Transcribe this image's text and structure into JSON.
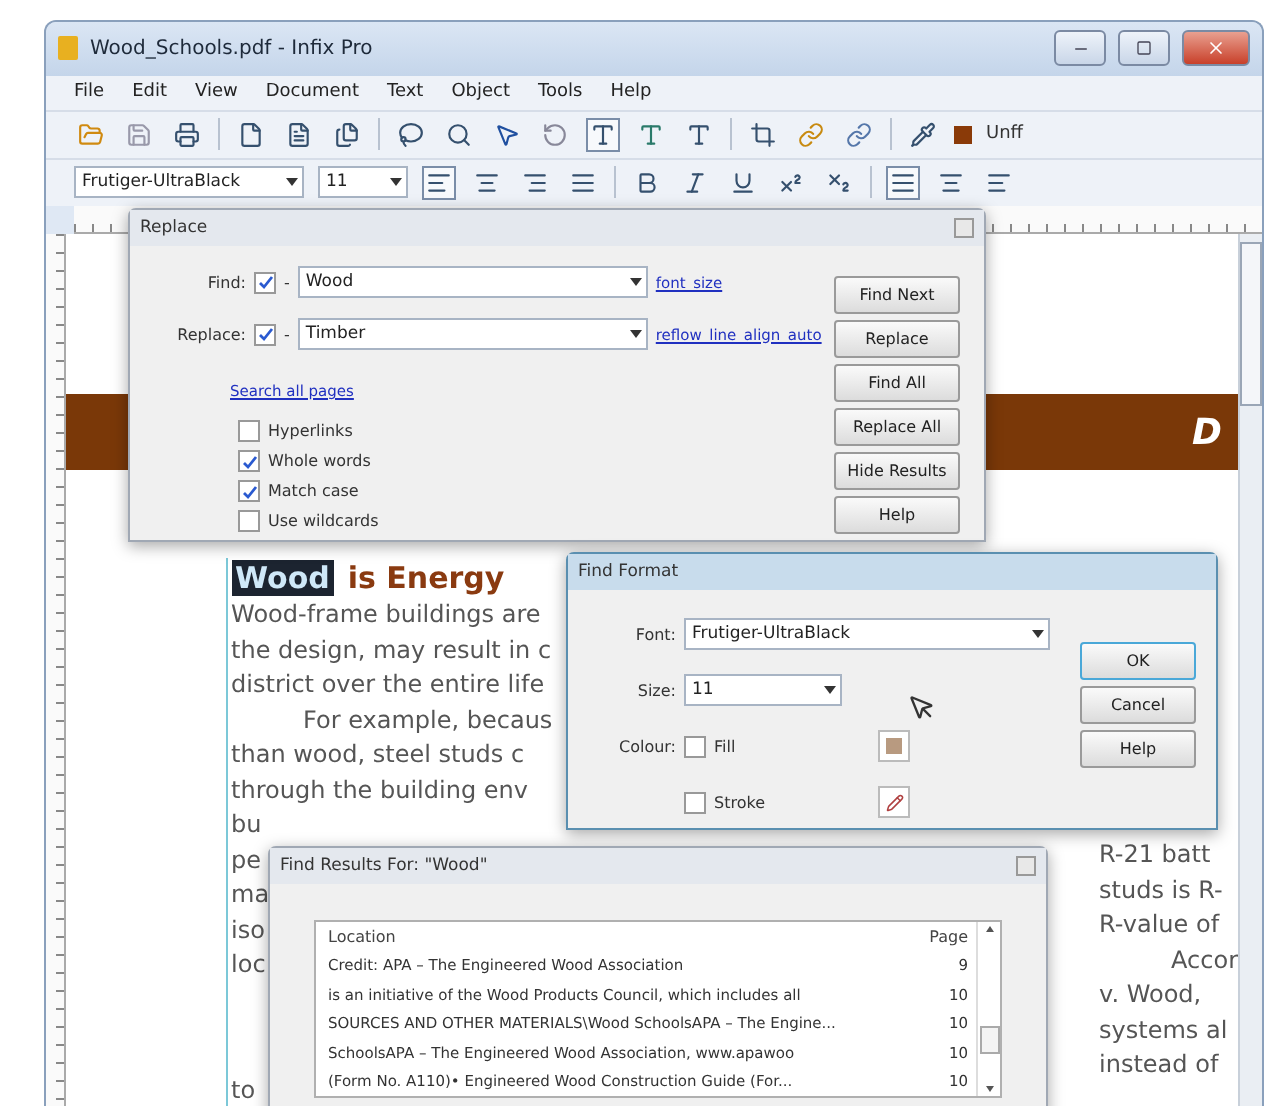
{
  "window": {
    "title": "Wood_Schools.pdf - Infix Pro"
  },
  "menu": [
    "File",
    "Edit",
    "View",
    "Document",
    "Text",
    "Object",
    "Tools",
    "Help"
  ],
  "toolbar": {
    "color_label": "Unff"
  },
  "format_bar": {
    "font": "Frutiger-UltraBlack",
    "size": "11"
  },
  "document": {
    "banner_text": "D",
    "heading": [
      {
        "text": "Wood",
        "highlighted": true
      },
      {
        "text": "is Energy",
        "highlighted": false
      }
    ],
    "lines": [
      {
        "kind": "line",
        "text": "Wood-frame buildings are"
      },
      {
        "kind": "line",
        "text": "the design, may result in c"
      },
      {
        "kind": "line",
        "text": "district over the entire life"
      },
      {
        "kind": "indent",
        "text": "For example, becaus"
      },
      {
        "kind": "line",
        "text": "than wood, steel studs c"
      },
      {
        "kind": "line",
        "text": "through the building env"
      },
      {
        "kind": "line",
        "text": "bu"
      },
      {
        "kind": "line",
        "text": "pe"
      },
      {
        "kind": "line",
        "text": "ma"
      },
      {
        "kind": "line",
        "text": "iso"
      },
      {
        "kind": "line",
        "text": "loc"
      },
      {
        "kind": "gap"
      },
      {
        "kind": "line",
        "text": "to"
      }
    ],
    "right_lines": [
      {
        "kind": "line",
        "text": "R-21 batt"
      },
      {
        "kind": "line",
        "text": "studs is R-"
      },
      {
        "kind": "line",
        "text": "R-value of"
      },
      {
        "kind": "indent",
        "text": "Accor"
      },
      {
        "kind": "line",
        "text": "v. Wood,"
      },
      {
        "kind": "line",
        "text": "systems al"
      },
      {
        "kind": "line",
        "text": "instead of"
      }
    ]
  },
  "replace_dialog": {
    "title": "Replace",
    "fields": [
      {
        "label": "Find:",
        "checked": true,
        "mode": "-",
        "value": "Wood",
        "link": "font_size"
      },
      {
        "label": "Replace:",
        "checked": true,
        "mode": "-",
        "value": "Timber",
        "link": "reflow_line_align_auto"
      }
    ],
    "search_link": "Search all pages",
    "options": [
      {
        "label": "Hyperlinks",
        "checked": false
      },
      {
        "label": "Whole words",
        "checked": true
      },
      {
        "label": "Match case",
        "checked": true
      },
      {
        "label": "Use wildcards",
        "checked": false
      }
    ],
    "buttons": [
      "Find Next",
      "Replace",
      "Find All",
      "Replace All",
      "Hide Results",
      "Help"
    ]
  },
  "find_format_dialog": {
    "title": "Find Format",
    "font_label": "Font:",
    "font": "Frutiger-UltraBlack",
    "size_label": "Size:",
    "size": "11",
    "colour_label": "Colour:",
    "colours": [
      {
        "kind": "fill",
        "label": "Fill",
        "checked": false
      },
      {
        "kind": "stroke",
        "label": "Stroke",
        "checked": false
      }
    ],
    "buttons": [
      {
        "label": "OK",
        "default": true
      },
      {
        "label": "Cancel",
        "default": false
      },
      {
        "label": "Help",
        "default": false
      }
    ]
  },
  "results_dialog": {
    "title": "Find Results For: \"Wood\"",
    "columns": [
      "Location",
      "Page"
    ],
    "rows": [
      {
        "location": "Credit: APA – The Engineered Wood Association",
        "page": "9"
      },
      {
        "location": "is an initiative of the Wood Products Council, which includes all",
        "page": "10"
      },
      {
        "location": "SOURCES AND OTHER MATERIALS\\Wood SchoolsAPA – The Engine...",
        "page": "10"
      },
      {
        "location": "SchoolsAPA – The Engineered Wood Association, www.apawoo",
        "page": "10"
      },
      {
        "location": "(Form No. A110)• Engineered Wood Construction Guide (For...",
        "page": "10"
      }
    ]
  }
}
